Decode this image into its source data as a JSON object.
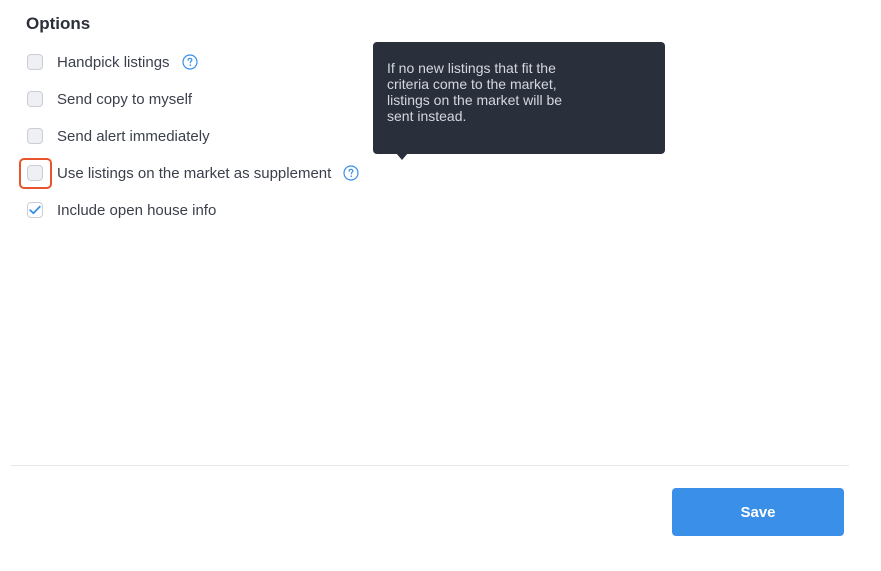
{
  "options": {
    "title": "Options",
    "items": [
      {
        "label": "Handpick listings",
        "checked": false,
        "has_help": true
      },
      {
        "label": "Send copy to myself",
        "checked": false,
        "has_help": false
      },
      {
        "label": "Send alert immediately",
        "checked": false,
        "has_help": false
      },
      {
        "label": "Use listings on the market as supplement",
        "checked": false,
        "has_help": true,
        "focused": true
      },
      {
        "label": "Include open house info",
        "checked": true,
        "has_help": false
      }
    ]
  },
  "tooltip": {
    "lines": [
      "If no new listings that fit the",
      "criteria come to the market,",
      "listings on the market will be",
      "sent instead."
    ]
  },
  "footer": {
    "save_label": "Save"
  },
  "colors": {
    "accent": "#3a8fe8",
    "focus_ring": "#e8542b",
    "tooltip_bg": "#2a2f3c",
    "help_icon": "#3a8fe8"
  },
  "icons": {
    "help": "question-circle-icon",
    "check": "checkmark-icon"
  }
}
